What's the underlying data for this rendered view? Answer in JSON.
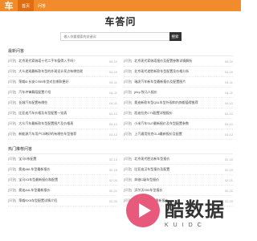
{
  "logo": "车",
  "nav": [
    {
      "label": "首页",
      "active": true
    },
    {
      "label": "问答",
      "active": false
    }
  ],
  "title": "车答问",
  "search": {
    "placeholder": "输入你要搜索的关键词",
    "button": "搜索"
  },
  "sections": [
    {
      "title": "最新问答",
      "items": [
        {
          "tag": "[问答]",
          "text": "北京现代索纳塔十代二手车值得入手吗?",
          "date": "04-10"
        },
        {
          "tag": "[问答]",
          "text": "北京现代索纳塔报价及配置参数详情解析",
          "date": "04-10"
        },
        {
          "tag": "[问答]",
          "text": "大众途观最新款车型的外观设计亮点有哪些呢",
          "date": "04-10"
        },
        {
          "tag": "[问答]",
          "text": "北京现代途胜新款车型配置及价格分析",
          "date": "04-10"
        },
        {
          "tag": "[问答]",
          "text": "荣威i5 长安CS55车型对比哪款更好",
          "date": "04-11"
        },
        {
          "tag": "[问答]",
          "text": "瑞虎汽车新车型最新报价及配置图片",
          "date": "04-11"
        },
        {
          "tag": "[问答]",
          "text": "汽车冲锋舞蹈配置介绍",
          "date": "04-11"
        },
        {
          "tag": "[问答]",
          "text": "jeep 牧马人报价",
          "date": "04-11"
        },
        {
          "tag": "[问答]",
          "text": "长城汽车配置有哪些",
          "date": "04-11"
        },
        {
          "tag": "[问答]",
          "text": "奥迪新款车型Q5L车型外观和内饰都值得推荐",
          "date": "04-12"
        },
        {
          "tag": "[问答]",
          "text": "比亚迪汽车价格及车型配置一览表",
          "date": "04-12"
        },
        {
          "tag": "[问答]",
          "text": "凯迪拉克CT5配置详细报价",
          "date": "04-12"
        },
        {
          "tag": "[问答]",
          "text": "大众汽车最新款车型配置图片及价格表",
          "date": "04-12"
        },
        {
          "tag": "[问答]",
          "text": "小米汽车SU7最新报价及车型配置参数",
          "date": "04-12"
        },
        {
          "tag": "[问答]",
          "text": "新能源汽车用户口碑好的有哪些车型推荐",
          "date": "04-12"
        },
        {
          "tag": "[问答]",
          "text": "上汽通用别克GL8最新报价及配置",
          "date": "04-12"
        }
      ]
    },
    {
      "title": "热门推荐问答",
      "items": [
        {
          "tag": "[问答]",
          "text": "宝马5系配置",
          "date": "02-14"
        },
        {
          "tag": "[问答]",
          "text": "北京现代胜达新车型报价",
          "date": "02-15"
        },
        {
          "tag": "[问答]",
          "text": "奥迪A6L车型最新报价",
          "date": "02-18"
        },
        {
          "tag": "[问答]",
          "text": "比亚迪汉车型报价及配置",
          "date": "02-19"
        },
        {
          "tag": "[问答]",
          "text": "宝马X3车型最新报价和配置",
          "date": "02-20"
        },
        {
          "tag": "[问答]",
          "text": "奔驰C级车型报价",
          "date": "02-21"
        },
        {
          "tag": "[问答]",
          "text": "奥迪A4L车型最新报价",
          "date": "02-21"
        },
        {
          "tag": "[问答]",
          "text": "沃尔沃S90车型报价",
          "date": "02-22"
        },
        {
          "tag": "[问答]",
          "text": "荣威RX5车型配置详情介绍",
          "date": "02-22"
        },
        {
          "tag": "[问答]",
          "text": "新款途观L车型最新报价",
          "date": "02-23"
        }
      ]
    }
  ],
  "watermark": {
    "cn": "酷数据",
    "en": "KUIDC"
  }
}
